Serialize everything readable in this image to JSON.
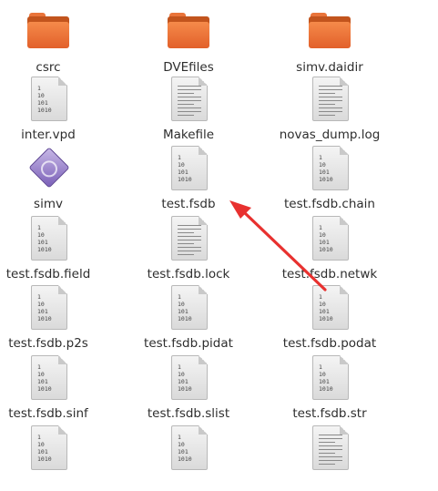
{
  "files": [
    {
      "name": "csrc",
      "icon": "folder-icon"
    },
    {
      "name": "DVEfiles",
      "icon": "folder-icon"
    },
    {
      "name": "simv.daidir",
      "icon": "folder-icon"
    },
    {
      "name": "inter.vpd",
      "icon": "binary-file-icon"
    },
    {
      "name": "Makefile",
      "icon": "text-file-icon"
    },
    {
      "name": "novas_dump.log",
      "icon": "text-file-icon"
    },
    {
      "name": "simv",
      "icon": "executable-icon"
    },
    {
      "name": "test.fsdb",
      "icon": "binary-file-icon"
    },
    {
      "name": "test.fsdb.chain",
      "icon": "binary-file-icon"
    },
    {
      "name": "test.fsdb.field",
      "icon": "binary-file-icon"
    },
    {
      "name": "test.fsdb.lock",
      "icon": "text-file-icon"
    },
    {
      "name": "test.fsdb.netwk",
      "icon": "binary-file-icon"
    },
    {
      "name": "test.fsdb.p2s",
      "icon": "binary-file-icon"
    },
    {
      "name": "test.fsdb.pidat",
      "icon": "binary-file-icon"
    },
    {
      "name": "test.fsdb.podat",
      "icon": "binary-file-icon"
    },
    {
      "name": "test.fsdb.sinf",
      "icon": "binary-file-icon"
    },
    {
      "name": "test.fsdb.slist",
      "icon": "binary-file-icon"
    },
    {
      "name": "test.fsdb.str",
      "icon": "binary-file-icon"
    },
    {
      "name": "",
      "icon": "binary-file-icon"
    },
    {
      "name": "",
      "icon": "binary-file-icon"
    },
    {
      "name": "",
      "icon": "text-file-icon"
    }
  ],
  "binary_glyph": [
    "1",
    "10",
    "101",
    "1010"
  ],
  "annotation_color": "#e8312f"
}
